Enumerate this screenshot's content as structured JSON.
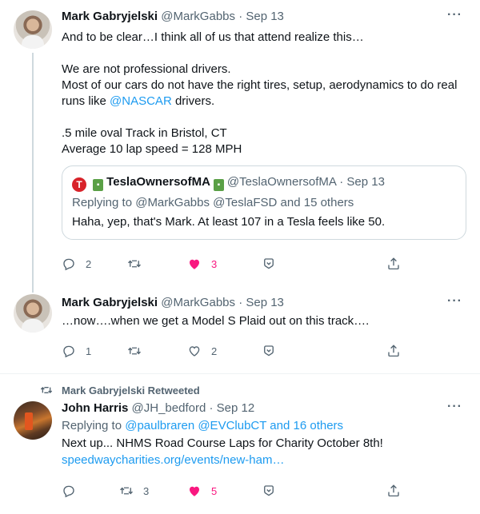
{
  "tweet1": {
    "name": "Mark Gabryjelski",
    "handle": "@MarkGabbs",
    "dot": "·",
    "time": "Sep 13",
    "line1": "And to be clear…I think all of us that attend realize this…",
    "line2": "We are not professional drivers.",
    "line3": "Most of our cars do not have the right tires, setup, aerodynamics to do real",
    "line4_pre": "runs like ",
    "line4_link": "@NASCAR",
    "line4_post": " drivers.",
    "line5": ".5 mile oval Track in Bristol, CT",
    "line6": "Average 10 lap speed = 128 MPH",
    "quote": {
      "tesla_glyph": "T",
      "badge1": "▪",
      "name": "TeslaOwnersofMA",
      "badge2": "▪",
      "handle": "@TeslaOwnersofMA",
      "dot": "·",
      "time": "Sep 13",
      "replying": "Replying to @MarkGabbs @TeslaFSD and 15 others",
      "text": "Haha, yep, that's Mark. At least 107 in a Tesla feels like 50."
    },
    "replies": "2",
    "retweets": "",
    "likes": "3",
    "liked": true
  },
  "tweet2": {
    "name": "Mark Gabryjelski",
    "handle": "@MarkGabbs",
    "dot": "·",
    "time": "Sep 13",
    "text": "…now….when we get a Model S Plaid out on this track….",
    "replies": "1",
    "retweets": "",
    "likes": "2",
    "liked": false
  },
  "tweet3": {
    "retweeted_by": "Mark Gabryjelski Retweeted",
    "name": "John Harris",
    "handle": "@JH_bedford",
    "dot": "·",
    "time": "Sep 12",
    "replying_label": "Replying to ",
    "replying_links": "@paulbraren @EVClubCT and 16 others",
    "text": "Next up... NHMS Road Course Laps for Charity October 8th!",
    "link": "speedwaycharities.org/events/new-ham…",
    "replies": "",
    "retweets": "3",
    "likes": "5",
    "liked": true
  },
  "more_glyph": "···",
  "colors": {
    "accent": "#1d9bf0",
    "like": "#f91880",
    "muted": "#536471",
    "border": "#cfd9de"
  },
  "icons": [
    "reply-icon",
    "retweet-icon",
    "heart-icon",
    "heart-filled-icon",
    "bookmark-icon",
    "share-icon",
    "more-icon",
    "tesla-logo-icon",
    "badge-icon"
  ]
}
